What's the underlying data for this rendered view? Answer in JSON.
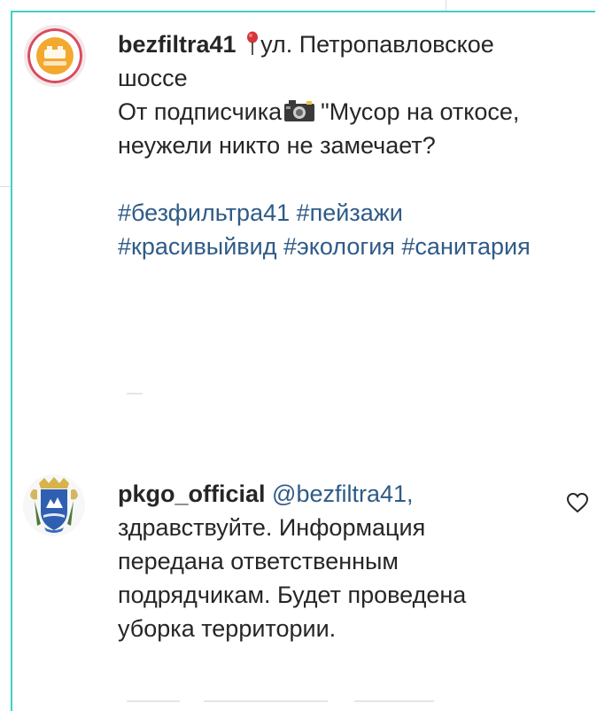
{
  "comments": [
    {
      "username": "bezfiltra41",
      "location_prefix": "ул. Петропавловское",
      "location_suffix": "шоссе",
      "line_from": "От подписчика",
      "quote_line1": "\"Мусор на откосе,",
      "quote_line2": "неужели никто не замечает?",
      "hashtags_line1": "#безфильтра41 #пейзажи",
      "hashtags_line2": "#красивыйвид #экология #санитария",
      "avatar_icon": "bezfiltra-logo-icon"
    },
    {
      "username": "pkgo_official",
      "mention": "@bezfiltra41,",
      "line1": "здравствуйте. Информация",
      "line2": "передана ответственным",
      "line3": "подрядчикам. Будет проведена",
      "line4": "уборка территории.",
      "avatar_icon": "city-coat-of-arms-icon",
      "like_icon": "heart-outline-icon"
    }
  ],
  "colors": {
    "frame_border": "#3fd0c9",
    "link": "#2f5b87",
    "text": "#262626"
  }
}
